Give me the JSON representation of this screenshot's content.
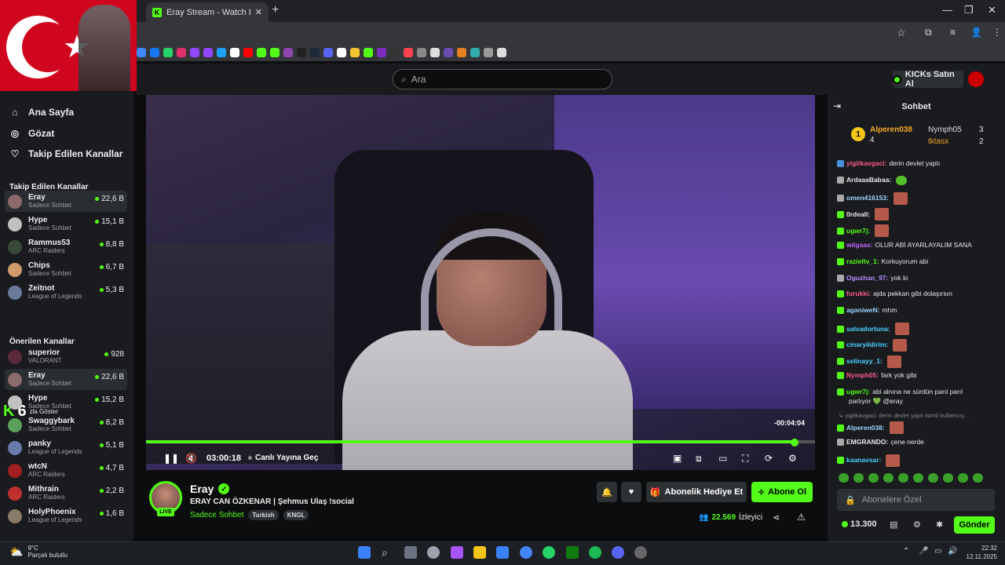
{
  "browser": {
    "tab_title": "Eray Stream - Watch Live on Kic",
    "new_tab": "+",
    "close_tab": "✕",
    "minimize": "—",
    "restore": "❐",
    "close": "✕",
    "bookmark_colors": [
      "#4285f4",
      "#1877f2",
      "#25d366",
      "#e1306c",
      "#9146ff",
      "#9146ff",
      "#1da1f2",
      "#fff",
      "#ff0000",
      "#53fc18",
      "#53fc18",
      "#8e44ad",
      "#222",
      "#1b2838",
      "#5865f2",
      "#fff",
      "#f4c430",
      "#53fc18",
      "#7b2cbf",
      "#333",
      "#ff424d",
      "#888",
      "#ddd",
      "#6a4bb0",
      "#e67e22",
      "#3aa",
      "#999",
      "#ddd"
    ]
  },
  "topbar": {
    "search_placeholder": "Ara",
    "kicks_label": "KICKs Satın Al"
  },
  "nav": {
    "home": "Ana Sayfa",
    "browse": "Gözat",
    "following": "Takip Edilen Kanallar"
  },
  "followed_header": "Takip Edilen Kanallar",
  "followed": [
    {
      "name": "Eray",
      "sub": "Sadece Sohbet",
      "viewers": "22,6 B",
      "color": "#8a6a6a"
    },
    {
      "name": "Hype",
      "sub": "Sadece Sohbet",
      "viewers": "15,1 B",
      "color": "#c0c0c0"
    },
    {
      "name": "Rammus53",
      "sub": "ARC Raiders",
      "viewers": "8,8 B",
      "color": "#3a4a3a"
    },
    {
      "name": "Chips",
      "sub": "Sadece Sohbet",
      "viewers": "6,7 B",
      "color": "#d09a6a"
    },
    {
      "name": "Zeitnot",
      "sub": "League of Legends",
      "viewers": "5,3 B",
      "color": "#6a7a9a"
    }
  ],
  "show_more": {
    "count": "6",
    "label": "zla Göster"
  },
  "recommended_header": "Önerilen Kanallar",
  "recommended": [
    {
      "name": "superior",
      "sub": "VALORANT",
      "viewers": "928",
      "color": "#5a2a3a"
    },
    {
      "name": "Eray",
      "sub": "Sadece Sohbet",
      "viewers": "22,6 B",
      "color": "#8a6a6a"
    },
    {
      "name": "Hype",
      "sub": "Sadece Sohbet",
      "viewers": "15,2 B",
      "color": "#c0c0c0"
    },
    {
      "name": "Swaggybark",
      "sub": "Sadece Sohbet",
      "viewers": "8,2 B",
      "color": "#5aa05a"
    },
    {
      "name": "panky",
      "sub": "League of Legends",
      "viewers": "5,1 B",
      "color": "#6a7aaa"
    },
    {
      "name": "wtcN",
      "sub": "ARC Raiders",
      "viewers": "4,7 B",
      "color": "#a02020"
    },
    {
      "name": "Mithrain",
      "sub": "ARC Raiders",
      "viewers": "2,2 B",
      "color": "#c03030"
    },
    {
      "name": "HolyPhoenix",
      "sub": "League of Legends",
      "viewers": "1,6 B",
      "color": "#8a7a6a"
    }
  ],
  "player": {
    "remaining": "-00:04:04",
    "time": "03:00:18",
    "go_live": "Canlı Yayına Geç",
    "progress": 0.97
  },
  "stream": {
    "live": "LIVE",
    "name": "Eray",
    "title": "ERAY CAN ÖZKENAR | Şehmus Ulaş !social",
    "category": "Sadece Sohbet",
    "tags": [
      "Turkish",
      "KNGL"
    ],
    "gift_label": "Abonelik Hediye Et",
    "subscribe_label": "Abone Ol",
    "viewers": "22.569",
    "viewers_label": "İzleyici"
  },
  "chat": {
    "title": "Sohbet",
    "leaders": [
      {
        "rank": "1",
        "name": "Alperen038",
        "count": "4",
        "color": "#f5a623"
      },
      {
        "name": "Nymph05",
        "count": "3",
        "color": "#cfcfcf"
      },
      {
        "name": "tktasx",
        "count": "2",
        "color": "#f5a623"
      }
    ],
    "messages": [
      {
        "user": "yigitkavgaci",
        "text": "derin devlet yaptı",
        "color": "#ff5a8a",
        "emote": "",
        "badge": "#4a90d9"
      },
      {
        "user": "ArdaaaBabaa",
        "text": "",
        "color": "#e8e8e8",
        "emote": "green",
        "badge": "#aaa"
      },
      {
        "user": "omen416153",
        "text": "",
        "color": "#9fd3ff",
        "emote": "face",
        "badge": "#aaa"
      },
      {
        "user": "0rdeall",
        "text": "",
        "color": "#e8e8e8",
        "emote": "face",
        "badge": "#53fc18"
      },
      {
        "user": "ugwr7j",
        "text": "",
        "color": "#53fc18",
        "emote": "face",
        "badge": "#53fc18"
      },
      {
        "user": "wilgaas",
        "text": "OLUR ABİ AYARLAYALIM SANA",
        "color": "#c266ff",
        "emote": "",
        "badge": "#53fc18"
      },
      {
        "user": "razieltv_1",
        "text": "Korkuyorum abi",
        "color": "#53fc18",
        "emote": "",
        "badge": "#53fc18"
      },
      {
        "user": "Oguzhan_97",
        "text": "yok ki",
        "color": "#b38cff",
        "emote": "",
        "badge": "#aaa"
      },
      {
        "user": "furukki",
        "text": "ajda pekkan gibi dolaşırsın",
        "color": "#ff5a8a",
        "emote": "",
        "badge": "#53fc18"
      },
      {
        "user": "aganiweN",
        "text": "mhm",
        "color": "#9fd3ff",
        "emote": "",
        "badge": "#53fc18"
      },
      {
        "user": "salvadortuna",
        "text": "",
        "color": "#4ad0ff",
        "emote": "face",
        "badge": "#53fc18"
      },
      {
        "user": "cinaryildirim",
        "text": "",
        "color": "#4ad0ff",
        "emote": "face",
        "badge": "#53fc18"
      },
      {
        "user": "selinayy_1",
        "text": "",
        "color": "#4ad0ff",
        "emote": "face",
        "badge": "#53fc18"
      },
      {
        "user": "Nymph05",
        "text": "fark yok gibi",
        "color": "#ff5a8a",
        "emote": "",
        "badge": "#53fc18"
      },
      {
        "user": "ugwr7j",
        "text": "abi alnına ne sürdün parıl parıl",
        "color": "#53fc18",
        "emote": "",
        "badge": "#53fc18"
      }
    ],
    "cont_line": "parlıyor 💚 @eray",
    "reply_line": "↳ yigitkavgaci: derin devlet yaptı isimli kullanıcıy...",
    "messages2": [
      {
        "user": "Alperen038",
        "text": "",
        "color": "#9fd3ff",
        "emote": "face",
        "badge": "#53fc18"
      },
      {
        "user": "EMGRANDO",
        "text": "çene nerde",
        "color": "#e8e8e8",
        "emote": "",
        "badge": "#aaa"
      },
      {
        "user": "kaanavsar",
        "text": "",
        "color": "#4ad0ff",
        "emote": "face",
        "badge": "#53fc18"
      }
    ],
    "input_placeholder": "Abonelere Özel",
    "points": "13.300",
    "send_label": "Gönder"
  },
  "taskbar": {
    "temp": "9°C",
    "weather": "Parçalı bulutlu",
    "time": "22:32",
    "date": "12.11.2025"
  }
}
